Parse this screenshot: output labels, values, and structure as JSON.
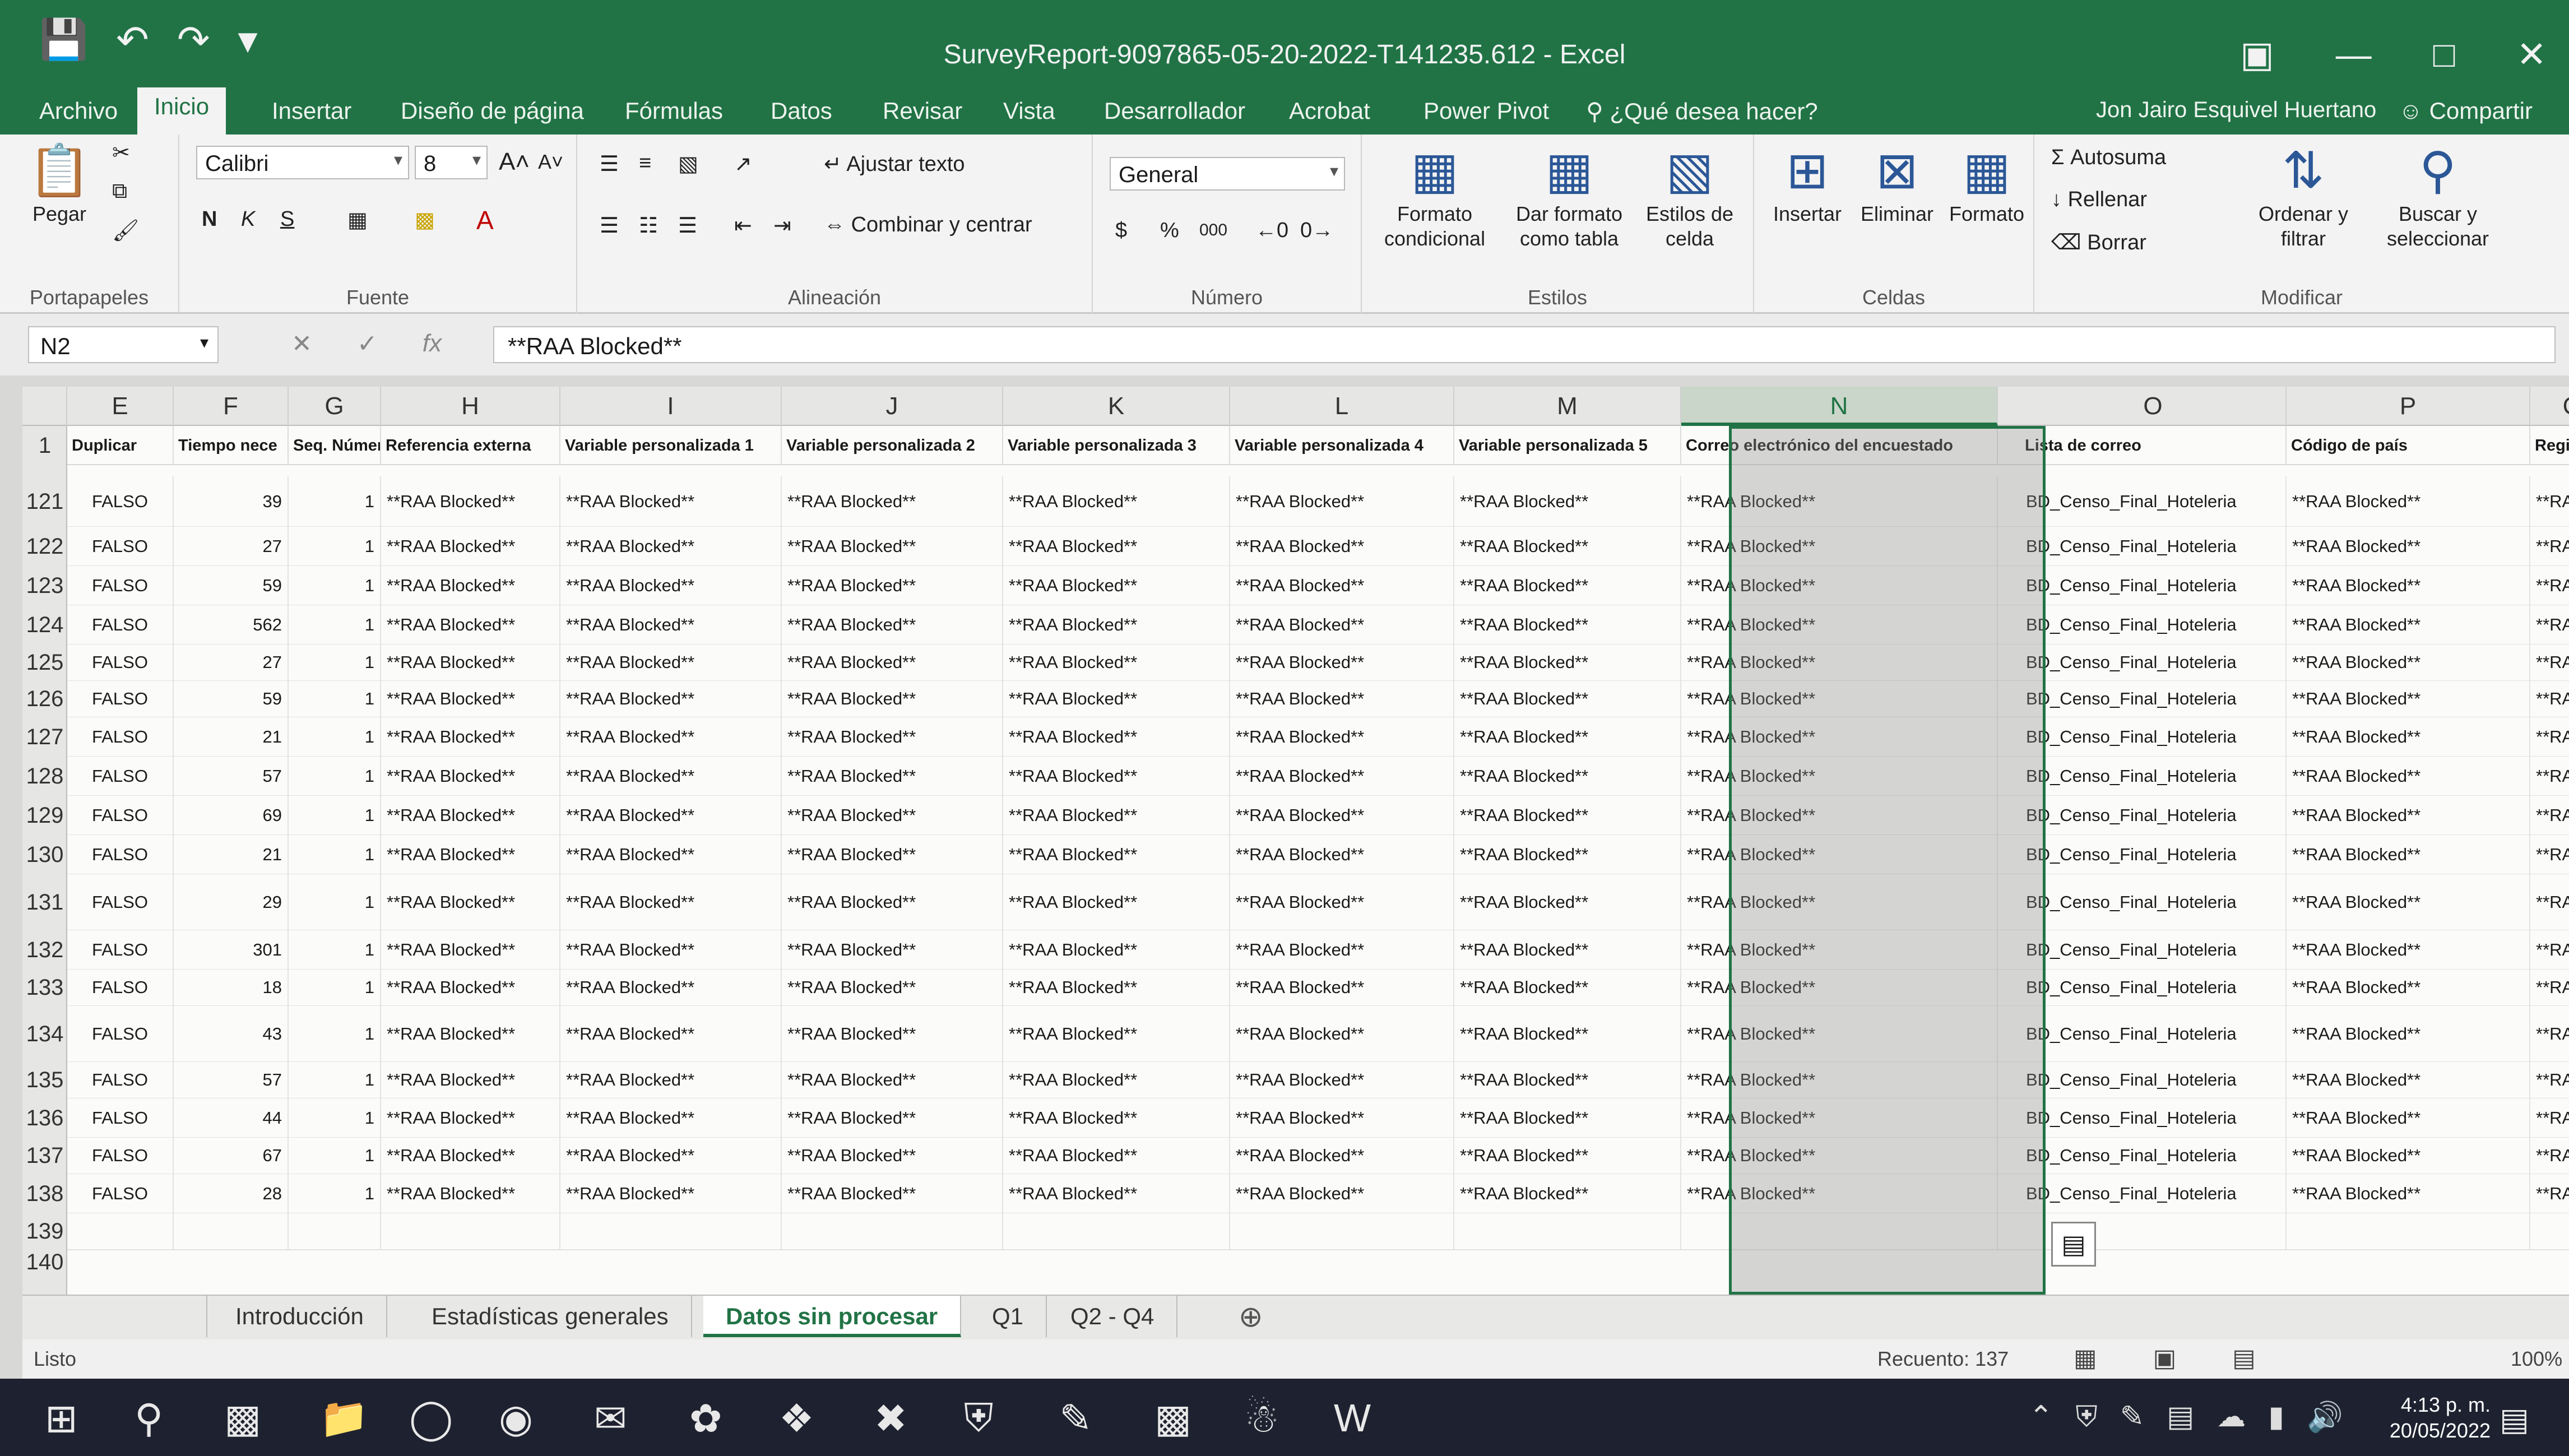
{
  "window": {
    "title": "SurveyReport-9097865-05-20-2022-T141235.612 - Excel",
    "colors": {
      "accent": "#217346",
      "selection": "#217346"
    }
  },
  "quick_access": [
    "save-icon",
    "undo-icon",
    "redo-icon",
    "customize-icon"
  ],
  "tabs": [
    {
      "label": "Archivo"
    },
    {
      "label": "Inicio"
    },
    {
      "label": "Insertar"
    },
    {
      "label": "Diseño de página"
    },
    {
      "label": "Fórmulas"
    },
    {
      "label": "Datos"
    },
    {
      "label": "Revisar"
    },
    {
      "label": "Vista"
    },
    {
      "label": "Desarrollador"
    },
    {
      "label": "Acrobat"
    },
    {
      "label": "Power Pivot"
    }
  ],
  "tell_me": "¿Qué desea hacer?",
  "user": "Jon Jairo Esquivel Huertano",
  "share": "Compartir",
  "ribbon": {
    "clipboard": {
      "paste": "Pegar",
      "label": "Portapapeles"
    },
    "font": {
      "name": "Calibri",
      "size": "8",
      "label": "Fuente",
      "bold": "N",
      "italic": "K",
      "underline": "S"
    },
    "alignment": {
      "wrap": "Ajustar texto",
      "merge": "Combinar y centrar",
      "label": "Alineación"
    },
    "number": {
      "format": "General",
      "currency": "$",
      "percent": "%",
      "thousands": "000",
      "label": "Número"
    },
    "styles": {
      "conditional": "Formato condicional",
      "as_table": "Dar formato como tabla",
      "cell_styles": "Estilos de celda",
      "label": "Estilos"
    },
    "cells": {
      "insert": "Insertar",
      "delete": "Eliminar",
      "format": "Formato",
      "label": "Celdas"
    },
    "editing": {
      "autosum": "Autosuma",
      "fill": "Rellenar",
      "clear": "Borrar",
      "sort": "Ordenar y filtrar",
      "find": "Buscar y seleccionar",
      "label": "Modificar"
    }
  },
  "formula_bar": {
    "name_box": "N2",
    "fx": "fx",
    "content": "**RAA Blocked**"
  },
  "columns": [
    {
      "id": "E"
    },
    {
      "id": "F"
    },
    {
      "id": "G"
    },
    {
      "id": "H"
    },
    {
      "id": "I"
    },
    {
      "id": "J"
    },
    {
      "id": "K"
    },
    {
      "id": "L"
    },
    {
      "id": "M"
    },
    {
      "id": "N",
      "selected": true
    },
    {
      "id": "O"
    },
    {
      "id": "P"
    },
    {
      "id": "C"
    }
  ],
  "header_row": {
    "num": "1",
    "cells": [
      "Duplicar",
      "Tiempo nece",
      "Seq. Número",
      "Referencia externa",
      "Variable personalizada 1",
      "Variable personalizada 2",
      "Variable personalizada 3",
      "Variable personalizada 4",
      "Variable personalizada 5",
      "Correo electrónico del encuestado",
      "Lista de correo",
      "Código de país",
      "Región"
    ]
  },
  "rows": [
    {
      "num": "121",
      "dup": "FALSO",
      "time": "39",
      "seq": "1"
    },
    {
      "num": "122",
      "dup": "FALSO",
      "time": "27",
      "seq": "1"
    },
    {
      "num": "123",
      "dup": "FALSO",
      "time": "59",
      "seq": "1"
    },
    {
      "num": "124",
      "dup": "FALSO",
      "time": "562",
      "seq": "1"
    },
    {
      "num": "125",
      "dup": "FALSO",
      "time": "27",
      "seq": "1"
    },
    {
      "num": "126",
      "dup": "FALSO",
      "time": "59",
      "seq": "1"
    },
    {
      "num": "127",
      "dup": "FALSO",
      "time": "21",
      "seq": "1"
    },
    {
      "num": "128",
      "dup": "FALSO",
      "time": "57",
      "seq": "1"
    },
    {
      "num": "129",
      "dup": "FALSO",
      "time": "69",
      "seq": "1"
    },
    {
      "num": "130",
      "dup": "FALSO",
      "time": "21",
      "seq": "1"
    },
    {
      "num": "131",
      "dup": "FALSO",
      "time": "29",
      "seq": "1"
    },
    {
      "num": "132",
      "dup": "FALSO",
      "time": "301",
      "seq": "1"
    },
    {
      "num": "133",
      "dup": "FALSO",
      "time": "18",
      "seq": "1"
    },
    {
      "num": "134",
      "dup": "FALSO",
      "time": "43",
      "seq": "1"
    },
    {
      "num": "135",
      "dup": "FALSO",
      "time": "57",
      "seq": "1"
    },
    {
      "num": "136",
      "dup": "FALSO",
      "time": "44",
      "seq": "1"
    },
    {
      "num": "137",
      "dup": "FALSO",
      "time": "67",
      "seq": "1"
    },
    {
      "num": "138",
      "dup": "FALSO",
      "time": "28",
      "seq": "1"
    },
    {
      "num": "139"
    },
    {
      "num": "140"
    }
  ],
  "blocked_text": "**RAA Blocked**",
  "mail_list": "BD_Censo_Final_Hoteleria",
  "region_clip": "**RAA Bl",
  "sheets": [
    {
      "label": "Introducción"
    },
    {
      "label": "Estadísticas generales"
    },
    {
      "label": "Datos sin procesar",
      "active": true
    },
    {
      "label": "Q1"
    },
    {
      "label": "Q2 - Q4"
    }
  ],
  "status": {
    "ready": "Listo",
    "count": "Recuento: 137",
    "zoom": "100%"
  },
  "taskbar": {
    "icons": [
      "windows-start-icon",
      "search-icon",
      "task-view-icon",
      "file-explorer-icon",
      "edge-icon",
      "chrome-icon",
      "outlook-icon",
      "firefox-icon",
      "browser-icon",
      "excel-icon",
      "shield-icon",
      "notes-icon",
      "chart-icon",
      "teams-icon",
      "word-icon"
    ],
    "time": "4:13 p. m.",
    "date": "20/05/2022"
  }
}
